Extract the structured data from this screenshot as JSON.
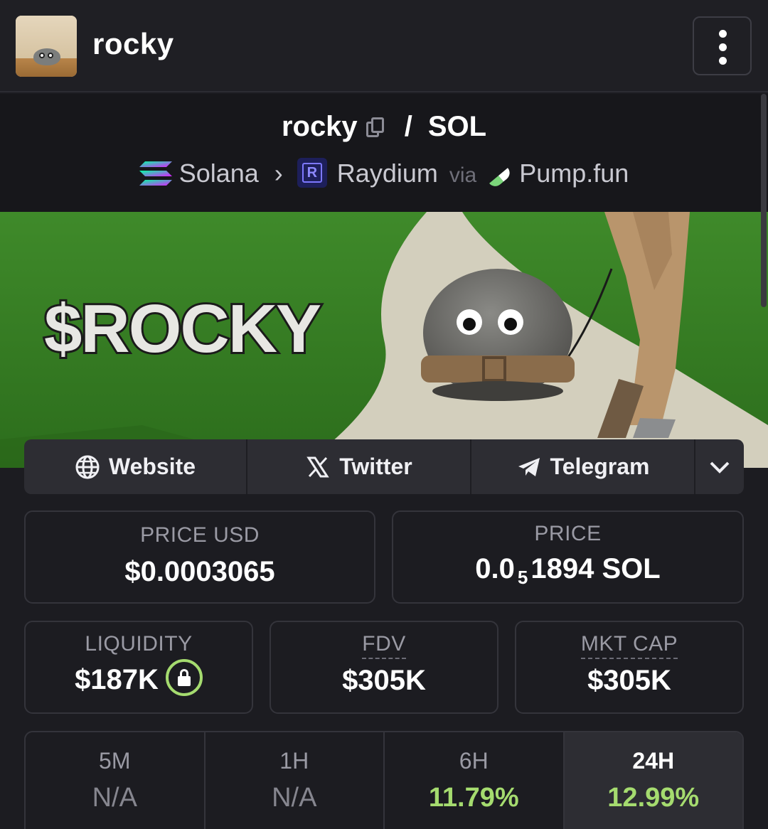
{
  "header": {
    "title": "rocky"
  },
  "pair": {
    "base": "rocky",
    "separator": "/",
    "quote": "SOL",
    "chain": "Solana",
    "dex": "Raydium",
    "via_label": "via",
    "launchpad": "Pump.fun"
  },
  "banner": {
    "text": "$ROCKY"
  },
  "links": {
    "website": "Website",
    "twitter": "Twitter",
    "telegram": "Telegram"
  },
  "stats": {
    "price_usd_label": "PRICE USD",
    "price_usd": "$0.0003065",
    "price_label": "PRICE",
    "price_prefix": "0.0",
    "price_zeros": "5",
    "price_rest": "1894 SOL",
    "liquidity_label": "LIQUIDITY",
    "liquidity": "$187K",
    "fdv_label": "FDV",
    "fdv": "$305K",
    "mktcap_label": "MKT CAP",
    "mktcap": "$305K"
  },
  "timeframes": [
    {
      "label": "5M",
      "value": "N/A"
    },
    {
      "label": "1H",
      "value": "N/A"
    },
    {
      "label": "6H",
      "value": "11.79%"
    },
    {
      "label": "24H",
      "value": "12.99%"
    }
  ],
  "colors": {
    "positive": "#a5db6f",
    "background": "#1c1c21",
    "accent_lock": "#a5db6f"
  }
}
